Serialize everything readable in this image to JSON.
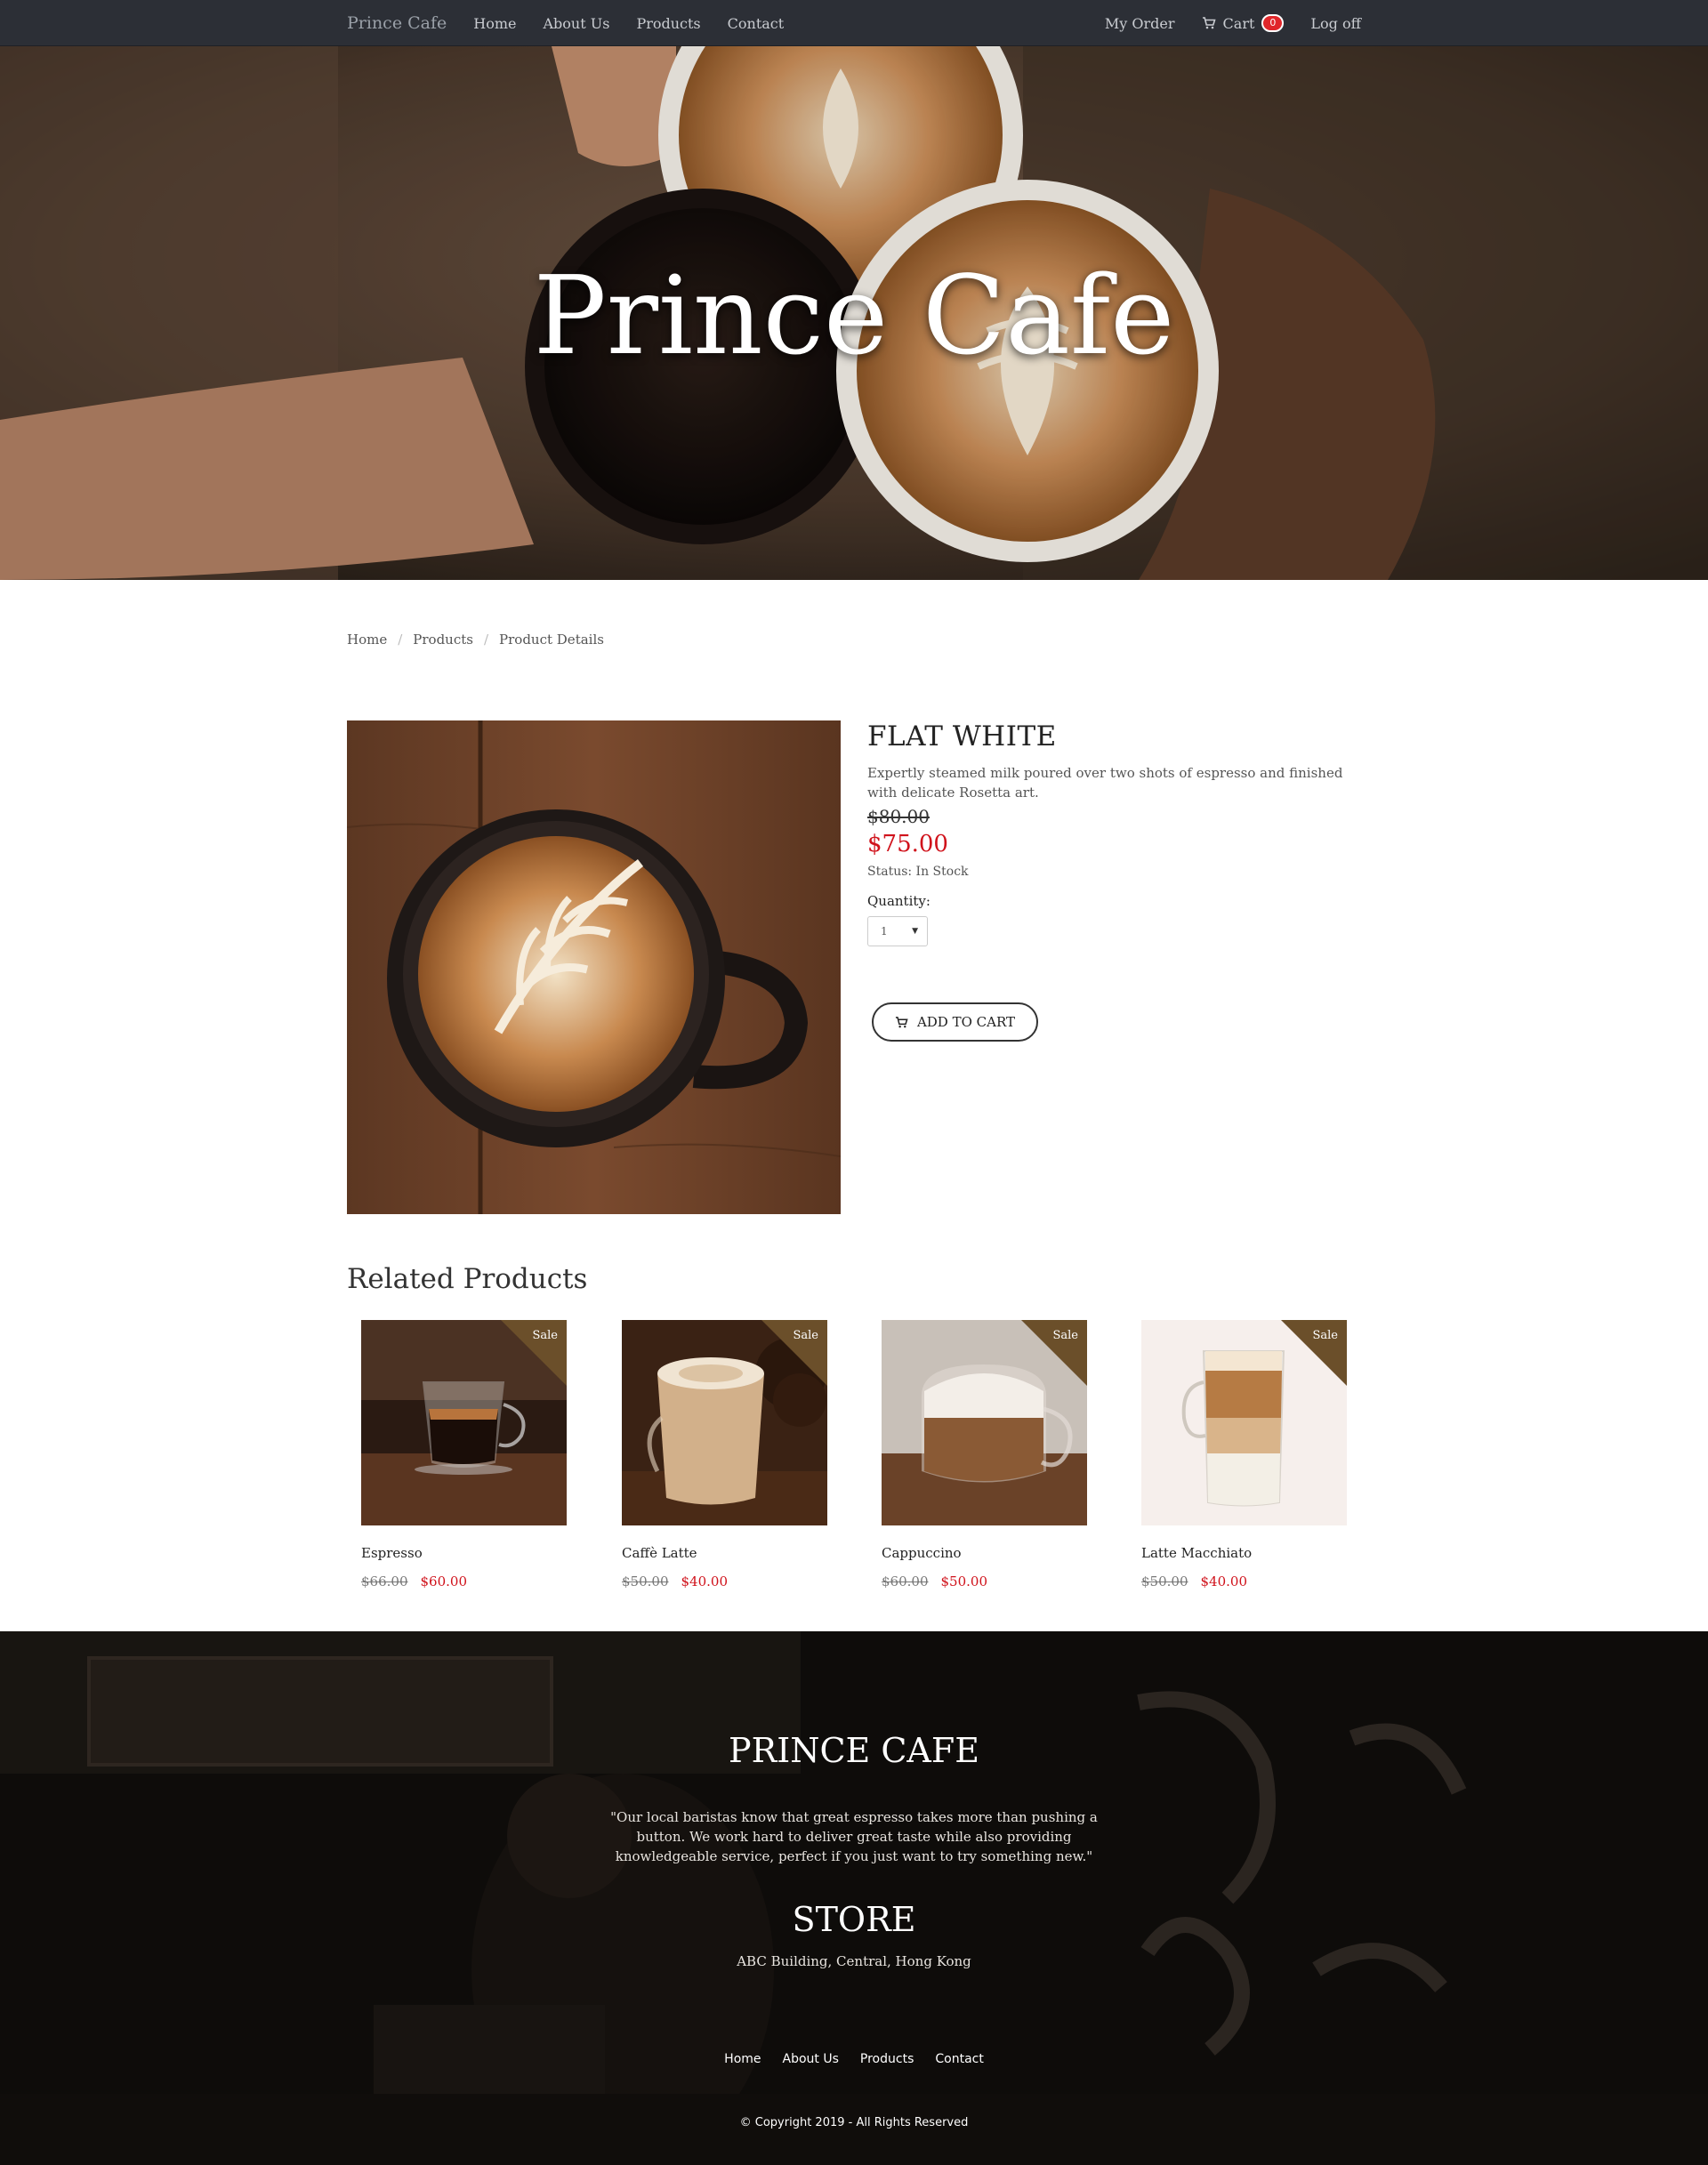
{
  "nav": {
    "brand": "Prince Cafe",
    "links": [
      "Home",
      "About Us",
      "Products",
      "Contact"
    ],
    "my_order": "My Order",
    "cart_label": "Cart",
    "cart_count": "0",
    "logoff": "Log off"
  },
  "hero": {
    "title": "Prince Cafe"
  },
  "breadcrumb": {
    "items": [
      "Home",
      "Products",
      "Product Details"
    ]
  },
  "product": {
    "name": "FLAT WHITE",
    "description": "Expertly steamed milk poured over two shots of espresso and finished with delicate Rosetta art.",
    "old_price": "$80.00",
    "new_price": "$75.00",
    "status": "Status: In Stock",
    "quantity_label": "Quantity:",
    "quantity_value": "1",
    "add_to_cart": "ADD TO CART"
  },
  "related": {
    "title": "Related Products",
    "items": [
      {
        "name": "Espresso",
        "old_price": "$66.00",
        "new_price": "$60.00",
        "badge": "Sale"
      },
      {
        "name": "Caffè Latte",
        "old_price": "$50.00",
        "new_price": "$40.00",
        "badge": "Sale"
      },
      {
        "name": "Cappuccino",
        "old_price": "$60.00",
        "new_price": "$50.00",
        "badge": "Sale"
      },
      {
        "name": "Latte Macchiato",
        "old_price": "$50.00",
        "new_price": "$40.00",
        "badge": "Sale"
      }
    ]
  },
  "footer": {
    "title": "PRINCE CAFE",
    "quote": "\"Our local baristas know that great espresso takes more than pushing a button. We work hard to deliver great taste while also providing knowledgeable service, perfect if you just want to try something new.\"",
    "store_title": "STORE",
    "store_address": "ABC Building, Central, Hong Kong",
    "links": [
      "Home",
      "About Us",
      "Products",
      "Contact"
    ],
    "copyright": "© Copyright 2019 - All Rights Reserved"
  },
  "colors": {
    "nav_bg": "#2c2f36",
    "accent_red": "#d0121b",
    "sale_badge": "#6b4f2a",
    "footer_bg": "#0d0c0b"
  }
}
